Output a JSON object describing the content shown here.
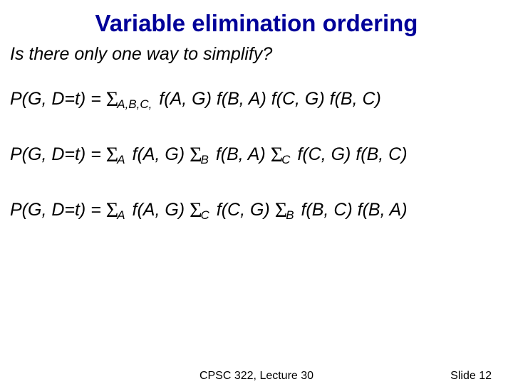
{
  "title": "Variable elimination ordering",
  "question": "Is there only one way to simplify?",
  "eq1": {
    "lhs": "P(G, D=t) = ",
    "sub1": "A,B,C,",
    "rhs1": " f(A, G) f(B, A) f(C, G) f(B, C)"
  },
  "eq2": {
    "lhs": "P(G, D=t) = ",
    "subA": "A",
    "t1": " f(A, G) ",
    "subB": "B",
    "t2": " f(B, A) ",
    "subC": "C",
    "t3": " f(C, G) f(B, C)"
  },
  "eq3": {
    "lhs": "P(G, D=t) = ",
    "subA": "A",
    "t1": " f(A, G) ",
    "subC": "C",
    "t2": " f(C, G) ",
    "subB": "B",
    "t3": " f(B, C) f(B, A)"
  },
  "footer": {
    "center": "CPSC 322, Lecture 30",
    "right": "Slide 12"
  },
  "sigma": "Σ"
}
